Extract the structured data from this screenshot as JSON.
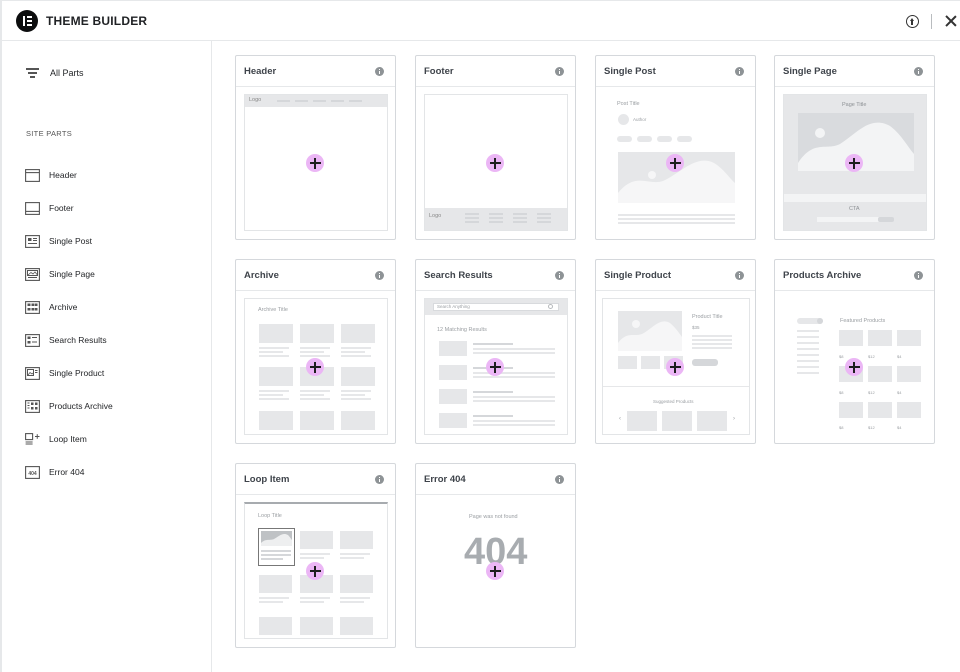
{
  "header": {
    "title": "THEME BUILDER"
  },
  "sidebar": {
    "all_parts": "All Parts",
    "section_title": "SITE PARTS",
    "items": [
      {
        "label": "Header"
      },
      {
        "label": "Footer"
      },
      {
        "label": "Single Post"
      },
      {
        "label": "Single Page"
      },
      {
        "label": "Archive"
      },
      {
        "label": "Search Results"
      },
      {
        "label": "Single Product"
      },
      {
        "label": "Products Archive"
      },
      {
        "label": "Loop Item"
      },
      {
        "label": "Error 404"
      }
    ]
  },
  "cards": [
    {
      "title": "Header"
    },
    {
      "title": "Footer"
    },
    {
      "title": "Single Post"
    },
    {
      "title": "Single Page"
    },
    {
      "title": "Archive"
    },
    {
      "title": "Search Results"
    },
    {
      "title": "Single Product"
    },
    {
      "title": "Products Archive"
    },
    {
      "title": "Loop Item"
    },
    {
      "title": "Error 404"
    }
  ],
  "previews": {
    "logo": "Logo",
    "post_title": "Post Title",
    "author": "Author",
    "page_title": "Page Title",
    "cta": "CTA",
    "archive_title": "Archive Title",
    "search_placeholder": "Search Anything",
    "matching_results": "12 Matching Results",
    "product_title": "Product Title",
    "product_price": "$35",
    "suggested_products": "Suggested Products",
    "featured_products": "Featured Products",
    "price_tags": [
      "$8",
      "$12",
      "$4",
      "$8",
      "$12",
      "$4",
      "$8",
      "$12",
      "$4",
      "$8",
      "$12",
      "$4"
    ],
    "loop_title": "Loop Title",
    "not_found": "Page was not found",
    "code_404": "404"
  }
}
